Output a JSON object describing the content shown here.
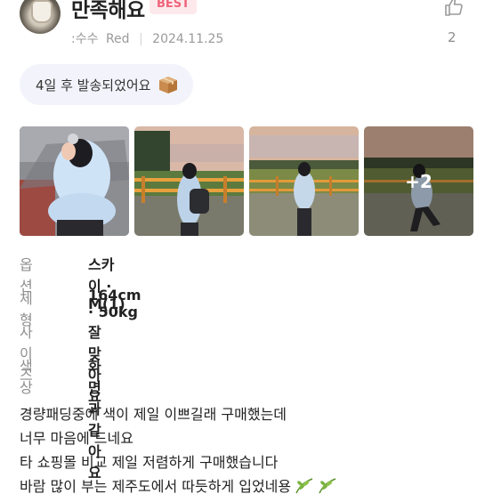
{
  "review": {
    "title": "만족해요",
    "badge": "BEST",
    "author": ":수수",
    "color_tag": "Red",
    "date": "2024.11.25",
    "like_count": "2",
    "shipping_text": "4일 후 발송되었어요",
    "shipping_icon": "package-box",
    "photos": [
      {
        "alt_icon": "photo-1"
      },
      {
        "alt_icon": "photo-2"
      },
      {
        "alt_icon": "photo-3"
      },
      {
        "alt_icon": "photo-4",
        "more_label": "+2"
      }
    ],
    "specs": [
      {
        "label": "옵션",
        "value": "스카이 · M(1)"
      },
      {
        "label": "체형",
        "value": "164cm · 50kg"
      },
      {
        "label": "사이즈",
        "value": "잘 맞아요"
      },
      {
        "label": "색상",
        "value": "화면과 같아요"
      }
    ],
    "body_lines": [
      "경량패딩중에 색이 제일 이쁘길래 구매했는데",
      "너무 마음에 드네요",
      "타 쇼핑몰 비교 제일 저렴하게 구매했습니다",
      "바람 많이 부는 제주도에서 따듯하게 입었네용"
    ]
  },
  "colors": {
    "badge_bg": "#fde9ec",
    "badge_text": "#f0637a",
    "shipping_bg": "#f3f4fb",
    "muted_text": "#9a9a9a"
  }
}
